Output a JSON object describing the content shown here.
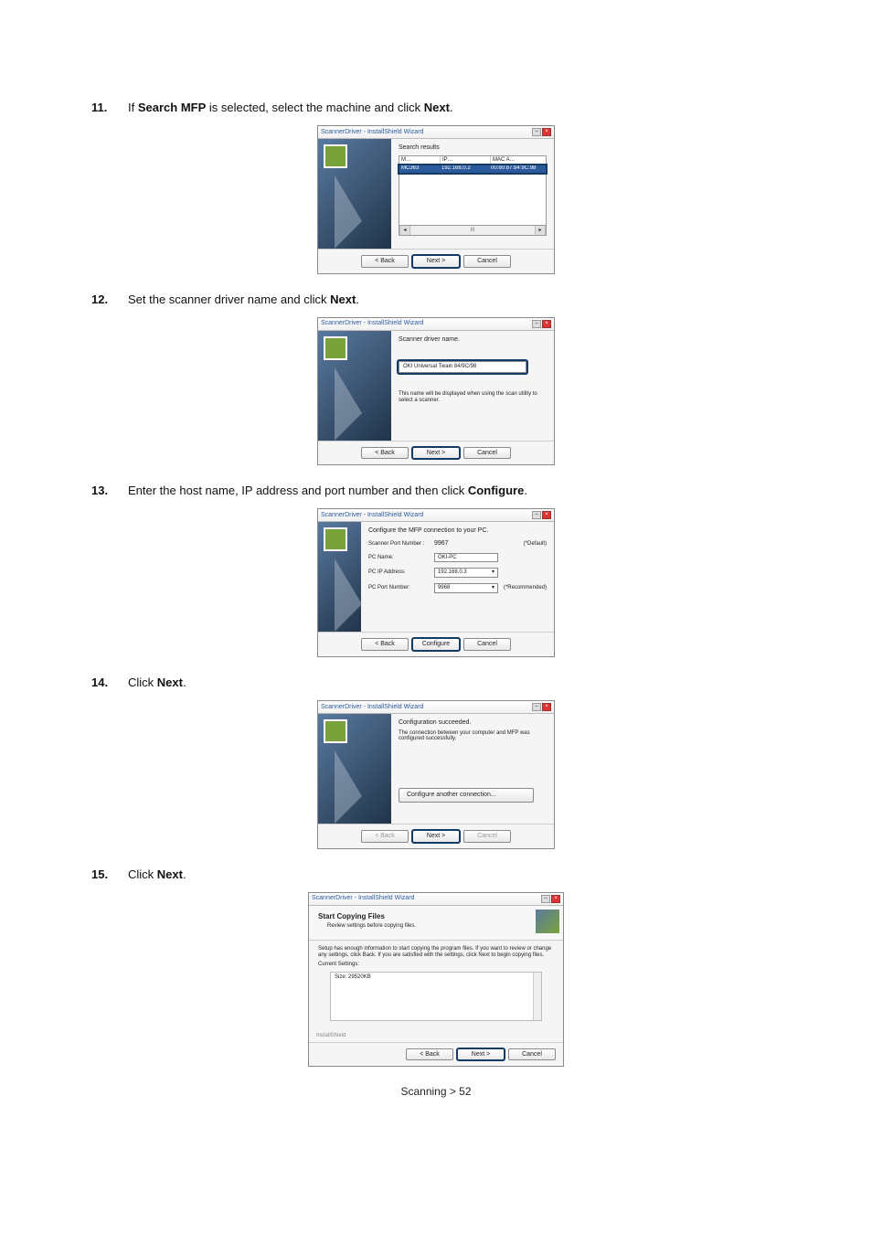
{
  "steps": {
    "s11": {
      "num": "11.",
      "prefix": "If ",
      "bold1": "Search MFP",
      "mid": " is selected, select the machine and click ",
      "bold2": "Next",
      "suffix": "."
    },
    "s12": {
      "num": "12.",
      "text": "Set the scanner driver name and click ",
      "bold": "Next",
      "suffix": "."
    },
    "s13": {
      "num": "13.",
      "text": "Enter the host name, IP address and port number and then click ",
      "bold": "Configure",
      "suffix": "."
    },
    "s14": {
      "num": "14.",
      "text": "Click ",
      "bold": "Next",
      "suffix": "."
    },
    "s15": {
      "num": "15.",
      "text": "Click ",
      "bold": "Next",
      "suffix": "."
    }
  },
  "common": {
    "title": "ScannerDriver - InstallShield Wizard",
    "back": "< Back",
    "next": "Next >",
    "cancel": "Cancel",
    "configure": "Configure",
    "installshield": "InstallShield"
  },
  "shot11": {
    "heading": "Search results",
    "hdr_name": "M…",
    "hdr_ip": "IP…",
    "hdr_mac": "MAC A…",
    "row_name": "MC363",
    "row_ip": "192.168.0.2",
    "row_mac": "00:80:87:84:9C:98",
    "scroll_mid": "III"
  },
  "shot12": {
    "heading": "Scanner driver name.",
    "driver_name": "OKI Universal Twain 84/9C/98",
    "note": "This name will be displayed when using the scan utility to select a scanner."
  },
  "shot13": {
    "heading": "Configure the MFP connection to your PC.",
    "port_lbl": "Scanner Port Number :",
    "port_val": "9967",
    "port_note": "(*Default)",
    "pcname_lbl": "PC Name:",
    "pcname_val": "OKI-PC",
    "ip_lbl": "PC IP Address:",
    "ip_val": "192.168.0.3",
    "pcport_lbl": "PC Port Number:",
    "pcport_val": "9968",
    "pcport_note": "(*Recommended)"
  },
  "shot14": {
    "heading": "Configuration succeeded.",
    "msg": "The connection between your computer and MFP was configured successfully.",
    "another": "Configure another connection..."
  },
  "shot15": {
    "h1": "Start Copying Files",
    "sub": "Review settings before copying files.",
    "body": "Setup has enough information to start copying the program files. If you want to review or change any settings, click Back. If you are satisfied with the settings, click Next to begin copying files.",
    "cur": "Current Settings:",
    "size": "Size: 29520KB"
  },
  "footer": "Scanning > 52"
}
